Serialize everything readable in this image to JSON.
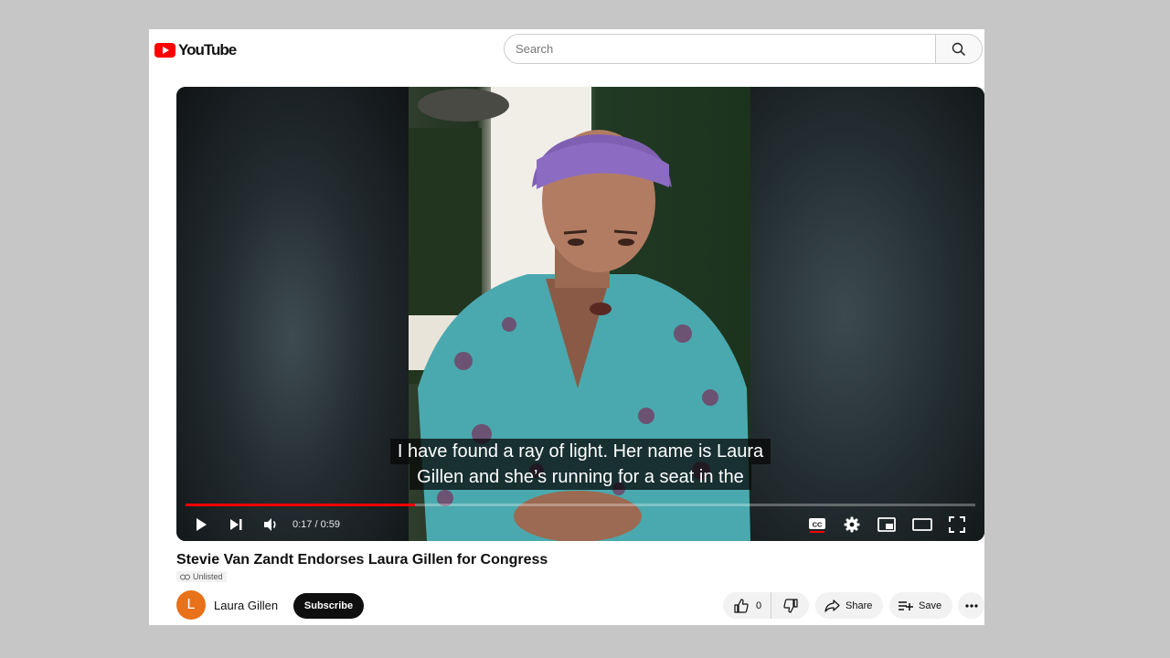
{
  "header": {
    "logo_text": "YouTube",
    "search_placeholder": "Search"
  },
  "player": {
    "captions": [
      "I have found a ray of light. Her name is Laura",
      "Gillen and she’s running for a seat in the"
    ],
    "time_display": "0:17 / 0:59",
    "progress_fraction": 0.29,
    "accent_color": "#ff0000"
  },
  "video": {
    "title": "Stevie Van Zandt Endorses Laura Gillen for Congress",
    "visibility": "Unlisted"
  },
  "channel": {
    "avatar_initial": "L",
    "name": "Laura Gillen",
    "subscribe_label": "Subscribe"
  },
  "actions": {
    "like_count": "0",
    "share_label": "Share",
    "save_label": "Save"
  },
  "icons": [
    "play-icon",
    "next-icon",
    "volume-icon",
    "cc-icon",
    "settings-icon",
    "miniplayer-icon",
    "theater-icon",
    "fullscreen-icon",
    "search-icon",
    "like-icon",
    "dislike-icon",
    "share-icon",
    "save-icon",
    "more-icon",
    "link-icon"
  ]
}
